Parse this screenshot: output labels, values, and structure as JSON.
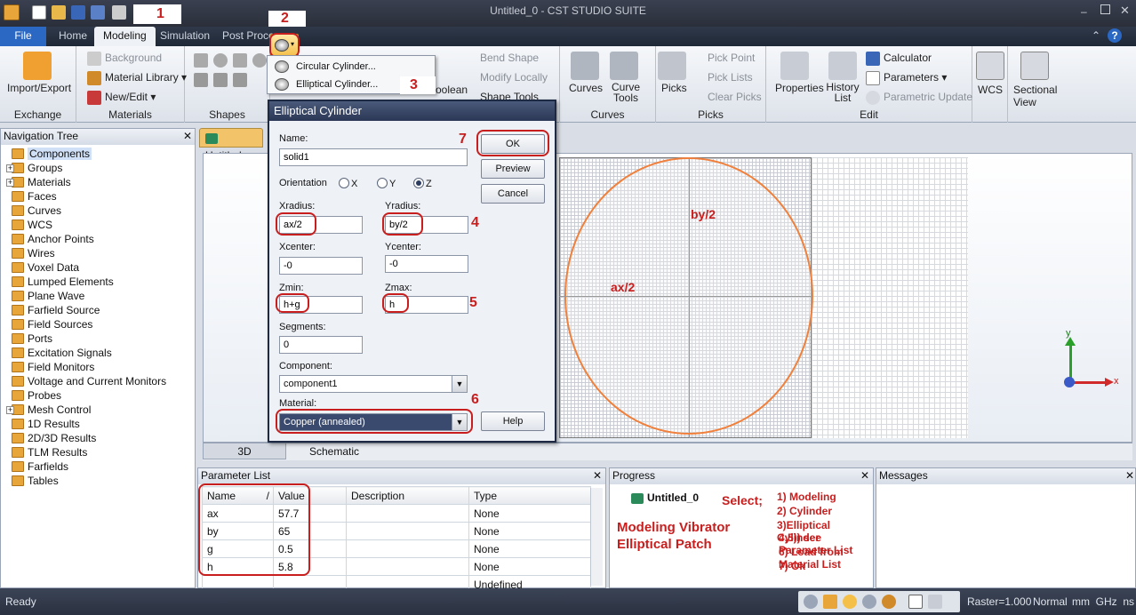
{
  "app": {
    "title": "Untitled_0 - CST STUDIO SUITE"
  },
  "menu": {
    "file": "File",
    "tabs": [
      {
        "label": "Home"
      },
      {
        "label": "Modeling"
      },
      {
        "label": "Simulation"
      },
      {
        "label": "Post Proce"
      }
    ],
    "active_tab": "Modeling"
  },
  "ribbon": {
    "exchange": {
      "label": "Exchange",
      "import_export": "Import/Export"
    },
    "materials": {
      "label": "Materials",
      "background": "Background",
      "material_library": "Material Library",
      "new_edit": "New/Edit"
    },
    "shapes": {
      "label": "Shapes"
    },
    "tools": {
      "bend_shape": "Bend Shape",
      "modify_locally": "Modify Locally",
      "boolean": "oolean",
      "shape_tools": "Shape Tools"
    },
    "curves": {
      "label": "Curves",
      "curves": "Curves",
      "curve_tools": "Curve Tools"
    },
    "picks": {
      "label": "Picks",
      "picks": "Picks",
      "pick_point": "Pick Point",
      "pick_lists": "Pick Lists",
      "clear_picks": "Clear Picks"
    },
    "edit": {
      "label": "Edit",
      "properties": "Properties",
      "history_list": "History List",
      "calculator": "Calculator",
      "parameters": "Parameters",
      "parametric_update": "Parametric Update"
    },
    "wcs": {
      "label": "WCS"
    },
    "sectional": {
      "label": "Sectional View"
    }
  },
  "cylinder_menu": {
    "items": [
      "Circular Cylinder...",
      "Elliptical Cylinder..."
    ]
  },
  "nav_tree": {
    "title": "Navigation Tree",
    "items": [
      {
        "label": "Components",
        "expand": false
      },
      {
        "label": "Groups",
        "expand": true
      },
      {
        "label": "Materials",
        "expand": true
      },
      {
        "label": "Faces",
        "expand": false
      },
      {
        "label": "Curves",
        "expand": false
      },
      {
        "label": "WCS",
        "expand": false
      },
      {
        "label": "Anchor Points",
        "expand": false
      },
      {
        "label": "Wires",
        "expand": false
      },
      {
        "label": "Voxel Data",
        "expand": false
      },
      {
        "label": "Lumped Elements",
        "expand": false
      },
      {
        "label": "Plane Wave",
        "expand": false
      },
      {
        "label": "Farfield Source",
        "expand": false
      },
      {
        "label": "Field Sources",
        "expand": false
      },
      {
        "label": "Ports",
        "expand": false
      },
      {
        "label": "Excitation Signals",
        "expand": false
      },
      {
        "label": "Field Monitors",
        "expand": false
      },
      {
        "label": "Voltage and Current Monitors",
        "expand": false
      },
      {
        "label": "Probes",
        "expand": false
      },
      {
        "label": "Mesh Control",
        "expand": true
      },
      {
        "label": "1D Results",
        "expand": false
      },
      {
        "label": "2D/3D Results",
        "expand": false
      },
      {
        "label": "TLM Results",
        "expand": false
      },
      {
        "label": "Farfields",
        "expand": false
      },
      {
        "label": "Tables",
        "expand": false
      }
    ]
  },
  "doc_tab": "Untitled_",
  "view_tabs": {
    "tab_3d": "3D",
    "schematic": "Schematic"
  },
  "viewport": {
    "label_by": "by/2",
    "label_ax": "ax/2",
    "axis_x": "x",
    "axis_y": "y"
  },
  "dialog": {
    "title": "Elliptical Cylinder",
    "name_label": "Name:",
    "name_value": "solid1",
    "orientation_label": "Orientation",
    "orient_x": "X",
    "orient_y": "Y",
    "orient_z": "Z",
    "xradius_label": "Xradius:",
    "xradius": "ax/2",
    "yradius_label": "Yradius:",
    "yradius": "by/2",
    "xcenter_label": "Xcenter:",
    "xcenter": "-0",
    "ycenter_label": "Ycenter:",
    "ycenter": "-0",
    "zmin_label": "Zmin:",
    "zmin": "h+g",
    "zmax_label": "Zmax:",
    "zmax": "h",
    "segments_label": "Segments:",
    "segments": "0",
    "component_label": "Component:",
    "component": "component1",
    "material_label": "Material:",
    "material": "Copper (annealed)",
    "ok": "OK",
    "preview": "Preview",
    "cancel": "Cancel",
    "help": "Help"
  },
  "params": {
    "title": "Parameter List",
    "headers": [
      "Name",
      "/",
      "Value",
      "Description",
      "Type"
    ],
    "rows": [
      {
        "name": "ax",
        "value": "57.7",
        "desc": "",
        "type": "None"
      },
      {
        "name": "by",
        "value": "65",
        "desc": "",
        "type": "None"
      },
      {
        "name": "g",
        "value": "0.5",
        "desc": "",
        "type": "None"
      },
      {
        "name": "h",
        "value": "5.8",
        "desc": "",
        "type": "None"
      },
      {
        "name": "",
        "value": "",
        "desc": "",
        "type": "Undefined"
      }
    ]
  },
  "progress": {
    "title": "Progress",
    "item": "Untitled_0",
    "select": "Select;",
    "heading_line1": "Modeling Vibrator",
    "heading_line2": "Elliptical Patch",
    "steps": [
      "1) Modeling",
      "2)  Cylinder",
      "3)Elliptical  Cylinder",
      "4,5)) see Parameter List",
      "6) Load from Material List",
      "7) Ok"
    ]
  },
  "messages": {
    "title": "Messages"
  },
  "status": {
    "ready": "Ready",
    "raster": "Raster=1.000",
    "mode": "Normal",
    "units": "mm  GHz  ns  K"
  },
  "annotations": [
    "1",
    "2",
    "3",
    "4",
    "5",
    "6",
    "7"
  ]
}
